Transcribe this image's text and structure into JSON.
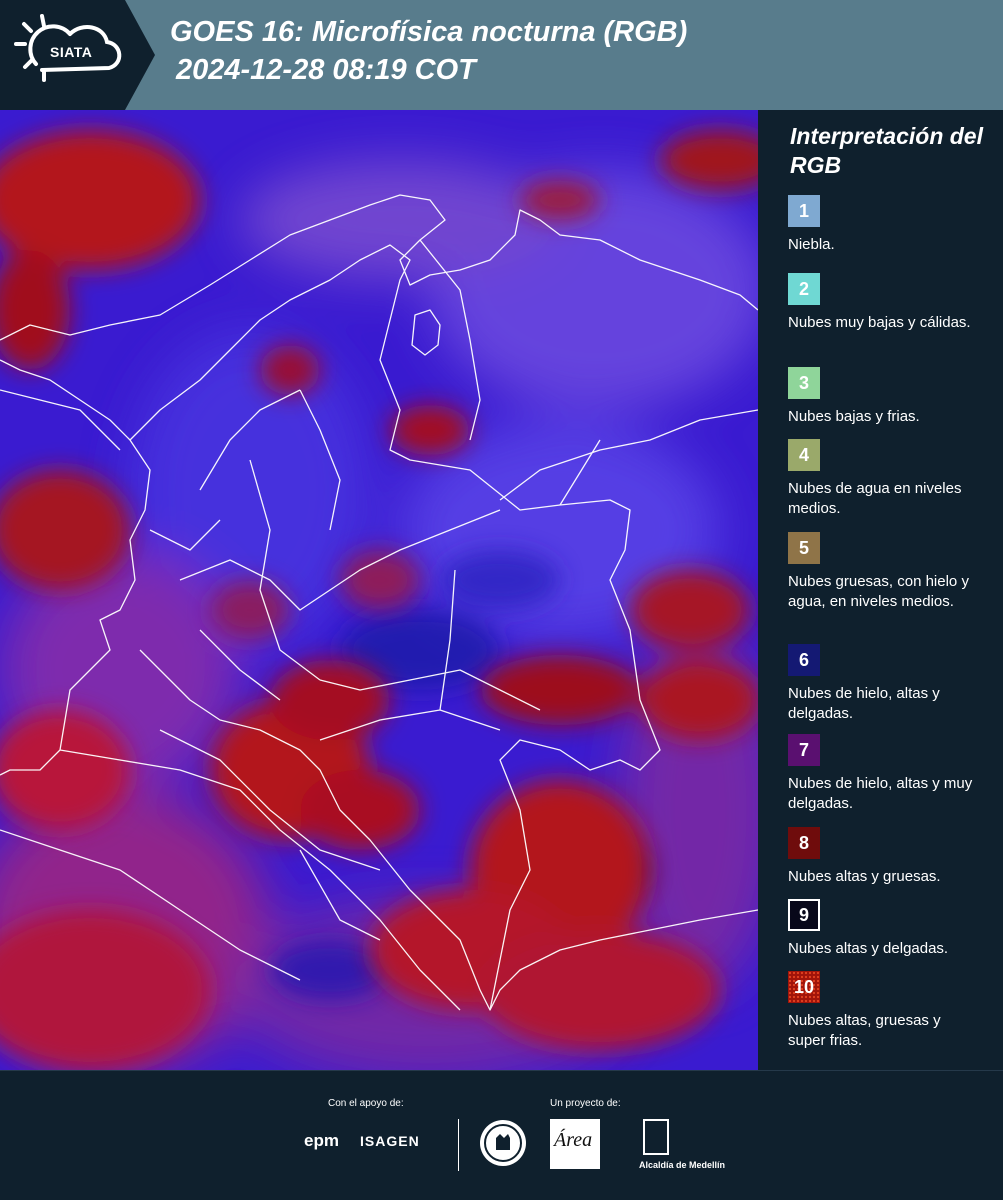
{
  "header": {
    "logo_text": "SIATA",
    "title_line1": "GOES 16: Microfísica nocturna (RGB)",
    "title_line2": "2024-12-28 08:19 COT"
  },
  "legend": {
    "title": "Interpretación del RGB",
    "items": [
      {
        "number": "1",
        "color": "#7fa9d1",
        "label": "Niebla."
      },
      {
        "number": "2",
        "color": "#6fd8d3",
        "label": "Nubes muy bajas y cálidas."
      },
      {
        "number": "3",
        "color": "#8fd59a",
        "label": "Nubes bajas y frias."
      },
      {
        "number": "4",
        "color": "#9aa96a",
        "label": "Nubes de agua en niveles medios."
      },
      {
        "number": "5",
        "color": "#8f7448",
        "label": "Nubes gruesas, con hielo y agua, en niveles medios."
      },
      {
        "number": "6",
        "color": "#141973",
        "label": "Nubes de hielo, altas y delgadas."
      },
      {
        "number": "7",
        "color": "#5a1070",
        "label": "Nubes de hielo, altas y muy delgadas."
      },
      {
        "number": "8",
        "color": "#6f0c0c",
        "label": "Nubes altas y gruesas."
      },
      {
        "number": "9",
        "color": "#08081a",
        "label": "Nubes altas y delgadas."
      },
      {
        "number": "10",
        "color": "#a1140a",
        "label": "Nubes altas, gruesas y super frias."
      }
    ]
  },
  "footer": {
    "support_label": "Con el apoyo de:",
    "project_label": "Un proyecto de:",
    "sponsor_epm": "epm",
    "sponsor_isagen": "ISAGEN",
    "medellin_label": "Alcaldía de Medellín",
    "area_logo_text": "Área"
  }
}
